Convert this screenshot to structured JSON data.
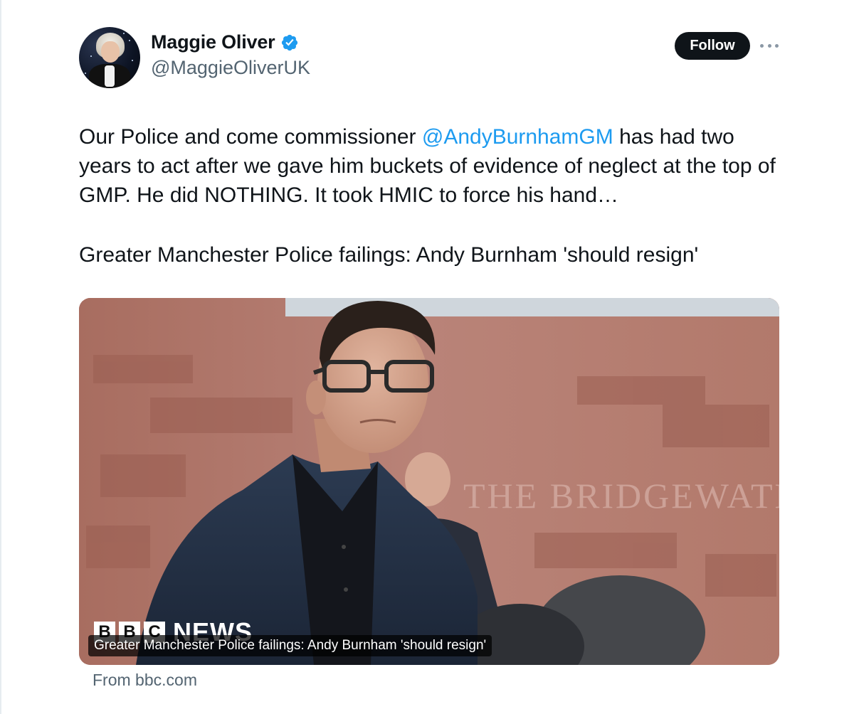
{
  "author": {
    "display_name": "Maggie Oliver",
    "handle": "@MaggieOliverUK",
    "verified": true,
    "verified_color": "#1d9bf0"
  },
  "actions": {
    "follow_label": "Follow",
    "more_icon": "more-horizontal-icon"
  },
  "tweet": {
    "text_before_mention": "Our Police and come commissioner ",
    "mention": "@AndyBurnhamGM",
    "text_after_mention": " has had two years to act after we gave him buckets of evidence of neglect at the top of GMP. He did NOTHING. It took HMIC to force his hand…",
    "headline": "Greater Manchester Police failings: Andy Burnham 'should resign'"
  },
  "card": {
    "logo_letters": [
      "B",
      "B",
      "C"
    ],
    "logo_word": "NEWS",
    "caption": "Greater Manchester Police failings: Andy Burnham 'should resign'",
    "source": "From bbc.com",
    "building_sign": "THE BRIDGEWATER"
  },
  "colors": {
    "text": "#0f1419",
    "secondary": "#536471",
    "link": "#1d9bf0",
    "button_bg": "#0f1419"
  }
}
